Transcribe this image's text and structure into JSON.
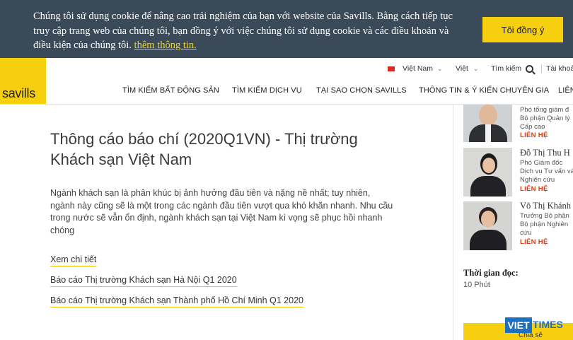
{
  "cookie_banner": {
    "text": "Chúng tôi sử dụng cookie để nâng cao trải nghiệm của bạn với website của Savills. Bằng cách tiếp tục truy cập trang web của chúng tôi, bạn đồng ý với việc chúng tôi sử dụng cookie và các điều khoản và điều kiện của chúng tôi.",
    "link_label": "thêm thông tin.",
    "accept_label": "Tôi đồng ý"
  },
  "header": {
    "logo": "savills",
    "country": "Việt Nam",
    "language": "Việt",
    "search_label": "Tìm kiếm",
    "account_label": "Tài khoả",
    "nav": [
      "TÌM KIẾM BẤT ĐỘNG SẢN",
      "TÌM KIẾM DỊCH VỤ",
      "TẠI SAO CHỌN SAVILLS",
      "THÔNG TIN & Ý KIẾN CHUYÊN GIA",
      "LIÊN"
    ]
  },
  "article": {
    "title": "Thông cáo báo chí (2020Q1VN) - Thị trường Khách sạn Việt Nam",
    "summary": "Ngành khách sạn là phân khúc bị ảnh hưởng đầu tiên và nặng nề nhất; tuy nhiên, ngành này cũng sẽ là một trong các ngành đầu tiên vượt qua khó khăn nhanh. Nhu cầu trong nước sẽ vẫn ổn định, ngành khách sạn tại Việt Nam kì vọng sẽ phục hồi nhanh chóng",
    "links": [
      "Xem chi tiết",
      "Báo cáo Thị trường Khách sạn Hà Nội Q1 2020",
      "Báo cáo Thị trường Khách sạn Thành phố Hồ Chí Minh Q1 2020"
    ]
  },
  "sidebar": {
    "contacts": [
      {
        "name": "",
        "role_lines": [
          "Phó tổng giám đ",
          "Bộ phận Quản lý",
          "Cấp cao"
        ],
        "link": "LIÊN HỆ"
      },
      {
        "name": "Đỗ Thị Thu H",
        "role_lines": [
          "Phó Giám đốc",
          "Dịch vụ Tư vấn và",
          "Nghiên cứu"
        ],
        "link": "LIÊN HỆ"
      },
      {
        "name": "Võ Thị Khánh",
        "role_lines": [
          "Trưởng Bộ phận",
          "Bộ phận Nghiên",
          "cứu"
        ],
        "link": "LIÊN HỆ"
      }
    ],
    "reading_time_label": "Thời gian đọc:",
    "reading_time_value": "10 Phút",
    "share_label": "Chia sẻ"
  },
  "watermark": {
    "boxed": "VIET",
    "rest": "TIMES"
  },
  "colors": {
    "brand_yellow": "#f6cf0e",
    "banner_bg": "#3b4a58",
    "contact_link": "#d4421b"
  }
}
